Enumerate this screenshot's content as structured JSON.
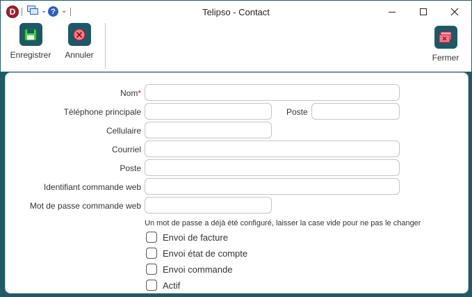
{
  "window": {
    "title": "Telipso - Contact",
    "app_logo_letter": "D"
  },
  "ribbon": {
    "save_label": "Enregistrer",
    "cancel_label": "Annuler",
    "close_label": "Fermer"
  },
  "form": {
    "nom_label": "Nom",
    "required_mark": "*",
    "nom_value": "",
    "tel_label": "Téléphone principale",
    "tel_value": "",
    "poste_inline_label": "Poste",
    "poste_inline_value": "",
    "cell_label": "Cellulaire",
    "cell_value": "",
    "courriel_label": "Courriel",
    "courriel_value": "",
    "poste_label": "Poste",
    "poste_value": "",
    "web_id_label": "Identifiant commande web",
    "web_id_value": "",
    "web_pwd_label": "Mot de passe commande web",
    "web_pwd_value": "",
    "hint": "Un mot de passe a déjà été configuré, laisser la case vide pour ne pas le changer"
  },
  "checkboxes": [
    {
      "label": "Envoi de facture",
      "checked": false
    },
    {
      "label": "Envoi état de compte",
      "checked": false
    },
    {
      "label": "Envoi commande",
      "checked": false
    },
    {
      "label": "Actif",
      "checked": false
    }
  ],
  "colors": {
    "accent": "#1e5866",
    "required": "#c0142a"
  }
}
